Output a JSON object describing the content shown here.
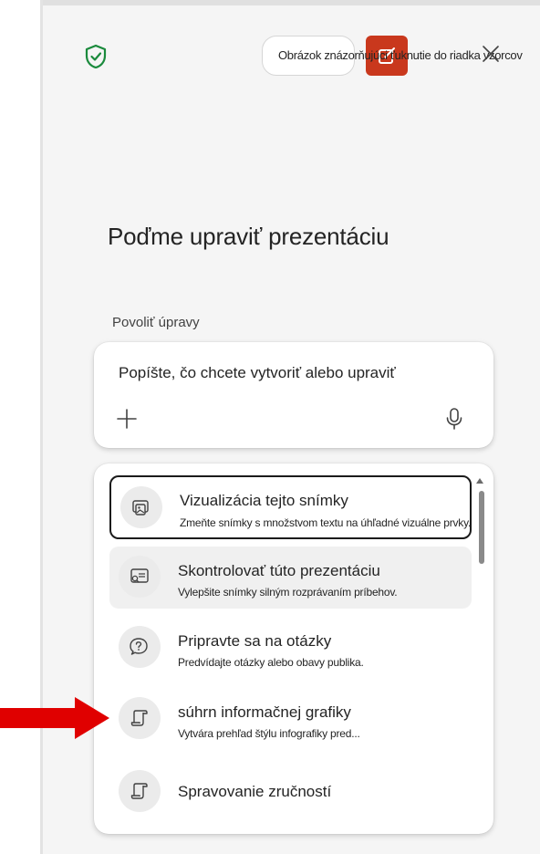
{
  "header": {
    "tooltip_text": "Obrázok znázorňujúci ťuknutie do riadka vzorcov",
    "copilot_color": "#c9381d",
    "shield_color": "#1a8a3c"
  },
  "main": {
    "title": "Poďme upraviť prezentáciu",
    "mode_label": "Povoliť úpravy",
    "input_placeholder": "Popíšte, čo chcete vytvoriť alebo upraviť"
  },
  "suggestions": [
    {
      "icon": "image-slide-icon",
      "title": "Vizualizácia tejto snímky",
      "desc": "Zmeňte snímky s množstvom textu na úhľadné vizuálne prvky."
    },
    {
      "icon": "slide-review-icon",
      "title": "Skontrolovať túto prezentáciu",
      "desc": "Vylepšite snímky silným rozprávaním príbehov."
    },
    {
      "icon": "chat-question-icon",
      "title": "Pripravte sa na otázky",
      "desc": "Predvídajte otázky alebo obavy publika."
    },
    {
      "icon": "scroll-icon",
      "title": "súhrn informačnej grafiky",
      "desc": "Vytvára prehľad štýlu infografiky pred..."
    },
    {
      "icon": "scroll-icon",
      "title": "Spravovanie zručností",
      "desc": ""
    }
  ],
  "annotation": {
    "arrow_color": "#e00000"
  }
}
